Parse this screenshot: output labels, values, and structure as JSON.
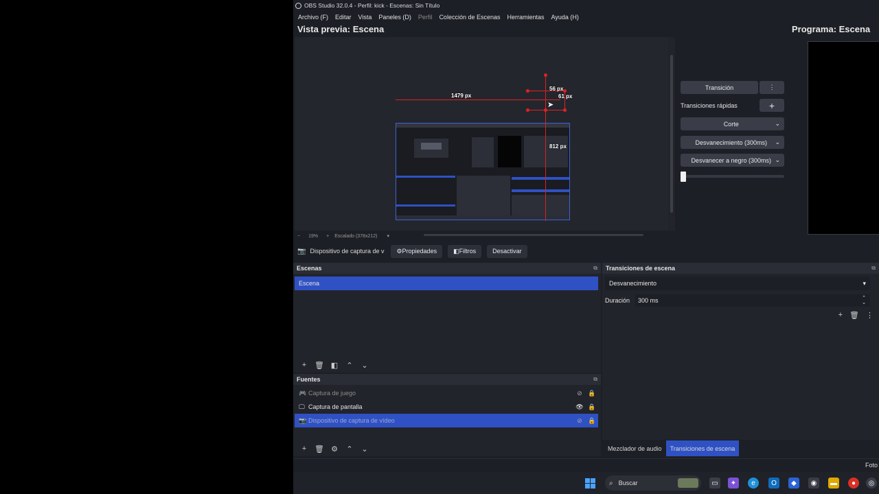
{
  "window": {
    "title": "OBS Studio 32.0.4 - Perfil: kick - Escenas: Sin Título"
  },
  "menu": [
    {
      "label": "Archivo (F)",
      "enabled": true
    },
    {
      "label": "Editar",
      "enabled": true
    },
    {
      "label": "Vista",
      "enabled": true
    },
    {
      "label": "Paneles (D)",
      "enabled": true
    },
    {
      "label": "Perfil",
      "enabled": false
    },
    {
      "label": "Colección de Escenas",
      "enabled": true
    },
    {
      "label": "Herramientas",
      "enabled": true
    },
    {
      "label": "Ayuda (H)",
      "enabled": true
    }
  ],
  "preview": {
    "title": "Vista previa: Escena",
    "measure_width": "1479 px",
    "measure_top": "56 px",
    "measure_right": "61 px",
    "measure_bottom": "812 px",
    "zoom_minus": "−",
    "zoom": "19%",
    "zoom_plus": "+",
    "scale_mode": "Escalado (378x212)",
    "scale_arrow": "▾"
  },
  "program": {
    "title": "Programa: Escena"
  },
  "transition_panel": {
    "transition_button": "Transición",
    "menu_icon": "⋮",
    "quick_label": "Transiciones rápidas",
    "add_icon": "+",
    "quick_items": [
      "Corte",
      "Desvanecimiento (300ms)",
      "Desvanecer a negro (300ms)"
    ],
    "t_bar_value": 0
  },
  "source_toolbar": {
    "source_name": "Dispositivo de captura de v",
    "properties": "Propiedades",
    "filters": "Filtros",
    "deactivate": "Desactivar"
  },
  "scenes": {
    "title": "Escenas",
    "items": [
      "Escena"
    ],
    "selected": 0
  },
  "sources": {
    "title": "Fuentes",
    "items": [
      {
        "name": "Captura de juego",
        "icon": "gamepad-icon",
        "visible": false,
        "muted": true
      },
      {
        "name": "Captura de pantalla",
        "icon": "monitor-icon",
        "visible": true,
        "muted": false
      },
      {
        "name": "Dispositivo de captura de vídeo",
        "icon": "camera-icon",
        "visible": false,
        "muted": true
      }
    ],
    "selected": 2
  },
  "scene_transitions": {
    "title": "Transiciones de escena",
    "transition": "Desvanecimiento",
    "duration_label": "Duración",
    "duration_value": "300 ms"
  },
  "dock_tabs": [
    "Mezclador de audio",
    "Transiciones de escena"
  ],
  "dock_tabs_active": 1,
  "statusbar": {
    "right_text": "Foto"
  },
  "taskbar": {
    "search_placeholder": "Buscar"
  },
  "colors": {
    "accent": "#2f51c4",
    "background": "#1d1f26",
    "guide_red": "#e32020"
  }
}
